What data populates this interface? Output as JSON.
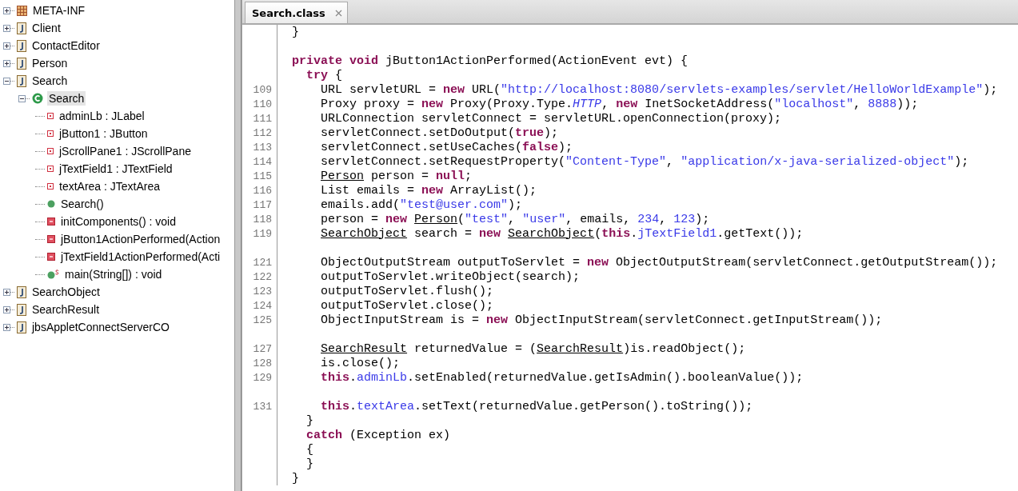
{
  "tree": [
    {
      "label": "META-INF",
      "kind": "folder",
      "expanded": false,
      "selected": false
    },
    {
      "label": "Client",
      "kind": "class-file",
      "expanded": false,
      "selected": false
    },
    {
      "label": "ContactEditor",
      "kind": "class-file",
      "expanded": false,
      "selected": false
    },
    {
      "label": "Person",
      "kind": "class-file",
      "expanded": false,
      "selected": false
    },
    {
      "label": "Search",
      "kind": "class-file",
      "expanded": true,
      "selected": false,
      "children": [
        {
          "label": "Search",
          "kind": "class",
          "expanded": true,
          "selected": true,
          "children": [
            {
              "label": "adminLb : JLabel",
              "kind": "field",
              "selected": false
            },
            {
              "label": "jButton1 : JButton",
              "kind": "field",
              "selected": false
            },
            {
              "label": "jScrollPane1 : JScrollPane",
              "kind": "field",
              "selected": false
            },
            {
              "label": "jTextField1 : JTextField",
              "kind": "field",
              "selected": false
            },
            {
              "label": "textArea : JTextArea",
              "kind": "field",
              "selected": false
            },
            {
              "label": "Search()",
              "kind": "constructor",
              "selected": false
            },
            {
              "label": "initComponents() : void",
              "kind": "method",
              "selected": false
            },
            {
              "label": "jButton1ActionPerformed(Action",
              "kind": "method",
              "selected": false
            },
            {
              "label": "jTextField1ActionPerformed(Acti",
              "kind": "method",
              "selected": false
            },
            {
              "label": "main(String[]) : void",
              "kind": "static-method",
              "selected": false
            }
          ]
        }
      ]
    },
    {
      "label": "SearchObject",
      "kind": "class-file",
      "expanded": false,
      "selected": false
    },
    {
      "label": "SearchResult",
      "kind": "class-file",
      "expanded": false,
      "selected": false
    },
    {
      "label": "jbsAppletConnectServerCO",
      "kind": "class-file",
      "expanded": false,
      "selected": false
    }
  ],
  "tabs": [
    {
      "label": "Search.class",
      "selected": true
    }
  ],
  "code": [
    {
      "tokens": [
        {
          "kind": "plain",
          "text": "  }"
        }
      ]
    },
    {
      "blank_before": true,
      "tokens": [
        {
          "kind": "keyword",
          "text": "  private void"
        },
        {
          "kind": "plain",
          "text": " jButton1ActionPerformed(ActionEvent evt) {"
        }
      ]
    },
    {
      "tokens": [
        {
          "kind": "keyword",
          "text": "    try"
        },
        {
          "kind": "plain",
          "text": " {"
        }
      ]
    },
    {
      "number": "109",
      "tokens": [
        {
          "kind": "plain",
          "text": "      URL servletURL = "
        },
        {
          "kind": "keyword",
          "text": "new"
        },
        {
          "kind": "plain",
          "text": " URL("
        },
        {
          "kind": "string",
          "text": "\"http://localhost:8080/servlets-examples/servlet/HelloWorldExample\""
        },
        {
          "kind": "plain",
          "text": ");"
        }
      ]
    },
    {
      "number": "110",
      "tokens": [
        {
          "kind": "plain",
          "text": "      Proxy proxy = "
        },
        {
          "kind": "keyword",
          "text": "new"
        },
        {
          "kind": "plain",
          "text": " Proxy(Proxy.Type."
        },
        {
          "kind": "constant",
          "text": "HTTP"
        },
        {
          "kind": "plain",
          "text": ", "
        },
        {
          "kind": "keyword",
          "text": "new"
        },
        {
          "kind": "plain",
          "text": " InetSocketAddress("
        },
        {
          "kind": "string",
          "text": "\"localhost\""
        },
        {
          "kind": "plain",
          "text": ", "
        },
        {
          "kind": "number",
          "text": "8888"
        },
        {
          "kind": "plain",
          "text": "));"
        }
      ]
    },
    {
      "number": "111",
      "tokens": [
        {
          "kind": "plain",
          "text": "      URLConnection servletConnect = servletURL.openConnection(proxy);"
        }
      ]
    },
    {
      "number": "112",
      "tokens": [
        {
          "kind": "plain",
          "text": "      servletConnect.setDoOutput("
        },
        {
          "kind": "keyword",
          "text": "true"
        },
        {
          "kind": "plain",
          "text": ");"
        }
      ]
    },
    {
      "number": "113",
      "tokens": [
        {
          "kind": "plain",
          "text": "      servletConnect.setUseCaches("
        },
        {
          "kind": "keyword",
          "text": "false"
        },
        {
          "kind": "plain",
          "text": ");"
        }
      ]
    },
    {
      "number": "114",
      "tokens": [
        {
          "kind": "plain",
          "text": "      servletConnect.setRequestProperty("
        },
        {
          "kind": "string",
          "text": "\"Content-Type\""
        },
        {
          "kind": "plain",
          "text": ", "
        },
        {
          "kind": "string",
          "text": "\"application/x-java-serialized-object\""
        },
        {
          "kind": "plain",
          "text": ");"
        }
      ]
    },
    {
      "number": "115",
      "tokens": [
        {
          "kind": "type-link",
          "text": "      Person"
        },
        {
          "kind": "plain",
          "text": " person = "
        },
        {
          "kind": "keyword",
          "text": "null"
        },
        {
          "kind": "plain",
          "text": ";"
        }
      ]
    },
    {
      "number": "116",
      "tokens": [
        {
          "kind": "plain",
          "text": "      List emails = "
        },
        {
          "kind": "keyword",
          "text": "new"
        },
        {
          "kind": "plain",
          "text": " ArrayList();"
        }
      ]
    },
    {
      "number": "117",
      "tokens": [
        {
          "kind": "plain",
          "text": "      emails.add("
        },
        {
          "kind": "string",
          "text": "\"test@user.com\""
        },
        {
          "kind": "plain",
          "text": ");"
        }
      ]
    },
    {
      "number": "118",
      "tokens": [
        {
          "kind": "plain",
          "text": "      person = "
        },
        {
          "kind": "keyword",
          "text": "new"
        },
        {
          "kind": "type-link",
          "text": " Person"
        },
        {
          "kind": "plain",
          "text": "("
        },
        {
          "kind": "string",
          "text": "\"test\""
        },
        {
          "kind": "plain",
          "text": ", "
        },
        {
          "kind": "string",
          "text": "\"user\""
        },
        {
          "kind": "plain",
          "text": ", emails, "
        },
        {
          "kind": "number",
          "text": "234"
        },
        {
          "kind": "plain",
          "text": ", "
        },
        {
          "kind": "number",
          "text": "123"
        },
        {
          "kind": "plain",
          "text": ");"
        }
      ]
    },
    {
      "number": "119",
      "tokens": [
        {
          "kind": "type-link",
          "text": "      SearchObject"
        },
        {
          "kind": "plain",
          "text": " search = "
        },
        {
          "kind": "keyword",
          "text": "new"
        },
        {
          "kind": "type-link",
          "text": " SearchObject"
        },
        {
          "kind": "plain",
          "text": "("
        },
        {
          "kind": "keyword",
          "text": "this"
        },
        {
          "kind": "plain",
          "text": "."
        },
        {
          "kind": "field",
          "text": "jTextField1"
        },
        {
          "kind": "plain",
          "text": ".getText());"
        }
      ]
    },
    {
      "blank_before": true,
      "number": "121",
      "tokens": [
        {
          "kind": "plain",
          "text": "      ObjectOutputStream outputToServlet = "
        },
        {
          "kind": "keyword",
          "text": "new"
        },
        {
          "kind": "plain",
          "text": " ObjectOutputStream(servletConnect.getOutputStream());"
        }
      ]
    },
    {
      "number": "122",
      "tokens": [
        {
          "kind": "plain",
          "text": "      outputToServlet.writeObject(search);"
        }
      ]
    },
    {
      "number": "123",
      "tokens": [
        {
          "kind": "plain",
          "text": "      outputToServlet.flush();"
        }
      ]
    },
    {
      "number": "124",
      "tokens": [
        {
          "kind": "plain",
          "text": "      outputToServlet.close();"
        }
      ]
    },
    {
      "number": "125",
      "tokens": [
        {
          "kind": "plain",
          "text": "      ObjectInputStream is = "
        },
        {
          "kind": "keyword",
          "text": "new"
        },
        {
          "kind": "plain",
          "text": " ObjectInputStream(servletConnect.getInputStream());"
        }
      ]
    },
    {
      "blank_before": true,
      "number": "127",
      "tokens": [
        {
          "kind": "type-link",
          "text": "      SearchResult"
        },
        {
          "kind": "plain",
          "text": " returnedValue = ("
        },
        {
          "kind": "type-link",
          "text": "SearchResult"
        },
        {
          "kind": "plain",
          "text": ")is.readObject();"
        }
      ]
    },
    {
      "number": "128",
      "tokens": [
        {
          "kind": "plain",
          "text": "      is.close();"
        }
      ]
    },
    {
      "number": "129",
      "tokens": [
        {
          "kind": "keyword",
          "text": "      this"
        },
        {
          "kind": "plain",
          "text": "."
        },
        {
          "kind": "field",
          "text": "adminLb"
        },
        {
          "kind": "plain",
          "text": ".setEnabled(returnedValue.getIsAdmin().booleanValue());"
        }
      ]
    },
    {
      "blank_before": true,
      "number": "131",
      "tokens": [
        {
          "kind": "keyword",
          "text": "      this"
        },
        {
          "kind": "plain",
          "text": "."
        },
        {
          "kind": "field",
          "text": "textArea"
        },
        {
          "kind": "plain",
          "text": ".setText(returnedValue.getPerson().toString());"
        }
      ]
    },
    {
      "tokens": [
        {
          "kind": "plain",
          "text": "    }"
        }
      ]
    },
    {
      "tokens": [
        {
          "kind": "keyword",
          "text": "    catch"
        },
        {
          "kind": "plain",
          "text": " (Exception ex)"
        }
      ]
    },
    {
      "tokens": [
        {
          "kind": "plain",
          "text": "    {"
        }
      ]
    },
    {
      "tokens": [
        {
          "kind": "plain",
          "text": "    }"
        }
      ]
    },
    {
      "tokens": [
        {
          "kind": "plain",
          "text": "  }"
        }
      ]
    }
  ]
}
